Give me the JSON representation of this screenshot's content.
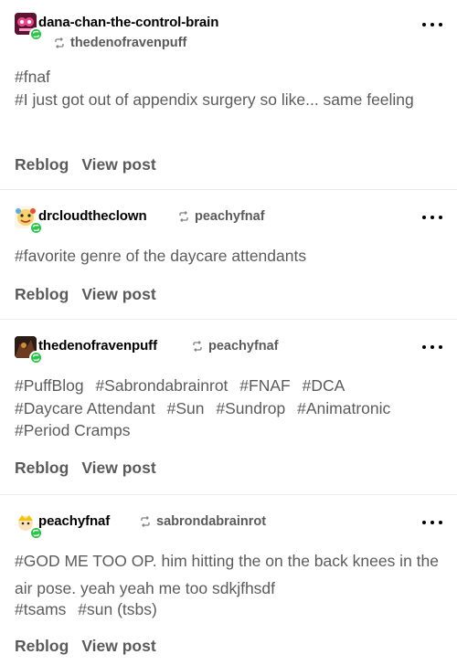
{
  "actions": {
    "reblog_label": "Reblog",
    "view_post_label": "View post"
  },
  "posts": [
    {
      "author": "dana-chan-the-control-brain",
      "reblogged_from": "thedenofravenpuff",
      "tags": [
        "#fnaf",
        "#I just got out of appendix surgery so like... same feeling"
      ]
    },
    {
      "author": "drcloudtheclown",
      "reblogged_from": "peachyfnaf",
      "tags": [
        "#favorite genre of the daycare attendants"
      ]
    },
    {
      "author": "thedenofravenpuff",
      "reblogged_from": "peachyfnaf",
      "tags": [
        "#PuffBlog",
        "#Sabrondabrainrot",
        "#FNAF",
        "#DCA",
        "#Daycare Attendant",
        "#Sun",
        "#Sundrop",
        "#Animatronic",
        "#Period Cramps"
      ]
    },
    {
      "author": "peachyfnaf",
      "reblogged_from": "sabrondabrainrot",
      "body": "#GOD ME TOO OP. him hitting the on the back knees in the air pose. yeah yeah me too sdkjfhsdf",
      "tags": [
        "#tsams",
        "#sun (tsbs)"
      ]
    }
  ],
  "colors": {
    "badge_green": "#2bc34a",
    "text_secondary": "#5b5b5b",
    "divider": "#ebebeb"
  }
}
